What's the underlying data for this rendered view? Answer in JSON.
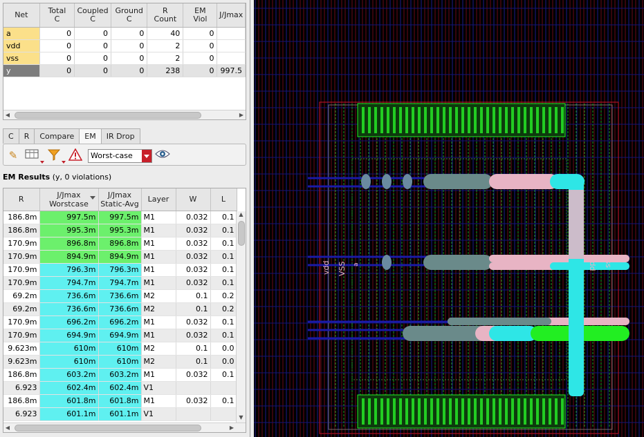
{
  "net_table": {
    "columns": [
      "Net",
      "Total\nC",
      "Coupled\nC",
      "Ground\nC",
      "R\nCount",
      "EM\nViol",
      "J/Jmax"
    ],
    "rows": [
      {
        "net": "a",
        "total_c": "0",
        "coupled_c": "0",
        "ground_c": "0",
        "r_count": "40",
        "em_viol": "0",
        "jjmax": ""
      },
      {
        "net": "vdd",
        "total_c": "0",
        "coupled_c": "0",
        "ground_c": "0",
        "r_count": "2",
        "em_viol": "0",
        "jjmax": ""
      },
      {
        "net": "vss",
        "total_c": "0",
        "coupled_c": "0",
        "ground_c": "0",
        "r_count": "2",
        "em_viol": "0",
        "jjmax": ""
      },
      {
        "net": "y",
        "total_c": "0",
        "coupled_c": "0",
        "ground_c": "0",
        "r_count": "238",
        "em_viol": "0",
        "jjmax": "997.5"
      }
    ]
  },
  "tabs": [
    "C",
    "R",
    "Compare",
    "EM",
    "IR Drop"
  ],
  "active_tab": "EM",
  "toolbar": {
    "mode": "Worst-case",
    "icons": [
      "pencil-icon",
      "column-chooser-icon",
      "filter-icon",
      "warning-icon",
      "eye-icon"
    ]
  },
  "em_results": {
    "title": "EM Results",
    "subtitle": "(y, 0 violations)",
    "columns": [
      "R",
      "J/Jmax\nWorstcase",
      "J/Jmax\nStatic-Avg",
      "Layer",
      "W",
      "L"
    ],
    "rows": [
      {
        "r": "186.8m",
        "wc": "997.5m",
        "sa": "997.5m",
        "layer": "M1",
        "w": "0.032",
        "l": "0.1",
        "color": "g"
      },
      {
        "r": "186.8m",
        "wc": "995.3m",
        "sa": "995.3m",
        "layer": "M1",
        "w": "0.032",
        "l": "0.1",
        "color": "g"
      },
      {
        "r": "170.9m",
        "wc": "896.8m",
        "sa": "896.8m",
        "layer": "M1",
        "w": "0.032",
        "l": "0.1",
        "color": "g"
      },
      {
        "r": "170.9m",
        "wc": "894.9m",
        "sa": "894.9m",
        "layer": "M1",
        "w": "0.032",
        "l": "0.1",
        "color": "g"
      },
      {
        "r": "170.9m",
        "wc": "796.3m",
        "sa": "796.3m",
        "layer": "M1",
        "w": "0.032",
        "l": "0.1",
        "color": "c"
      },
      {
        "r": "170.9m",
        "wc": "794.7m",
        "sa": "794.7m",
        "layer": "M1",
        "w": "0.032",
        "l": "0.1",
        "color": "c"
      },
      {
        "r": "69.2m",
        "wc": "736.6m",
        "sa": "736.6m",
        "layer": "M2",
        "w": "0.1",
        "l": "0.2",
        "color": "c"
      },
      {
        "r": "69.2m",
        "wc": "736.6m",
        "sa": "736.6m",
        "layer": "M2",
        "w": "0.1",
        "l": "0.2",
        "color": "c"
      },
      {
        "r": "170.9m",
        "wc": "696.2m",
        "sa": "696.2m",
        "layer": "M1",
        "w": "0.032",
        "l": "0.1",
        "color": "c"
      },
      {
        "r": "170.9m",
        "wc": "694.9m",
        "sa": "694.9m",
        "layer": "M1",
        "w": "0.032",
        "l": "0.1",
        "color": "c"
      },
      {
        "r": "9.623m",
        "wc": "610m",
        "sa": "610m",
        "layer": "M2",
        "w": "0.1",
        "l": "0.0",
        "color": "c"
      },
      {
        "r": "9.623m",
        "wc": "610m",
        "sa": "610m",
        "layer": "M2",
        "w": "0.1",
        "l": "0.0",
        "color": "c"
      },
      {
        "r": "186.8m",
        "wc": "603.2m",
        "sa": "603.2m",
        "layer": "M1",
        "w": "0.032",
        "l": "0.1",
        "color": "c"
      },
      {
        "r": "6.923",
        "wc": "602.4m",
        "sa": "602.4m",
        "layer": "V1",
        "w": "",
        "l": "",
        "color": "c"
      },
      {
        "r": "186.8m",
        "wc": "601.8m",
        "sa": "601.8m",
        "layer": "M1",
        "w": "0.032",
        "l": "0.1",
        "color": "c"
      },
      {
        "r": "6.923",
        "wc": "601.1m",
        "sa": "601.1m",
        "layer": "V1",
        "w": "",
        "l": "",
        "color": "c"
      }
    ]
  },
  "layout": {
    "labels": [
      "vdd",
      "VSS",
      "a",
      "vdd",
      "vss"
    ],
    "colors": {
      "background": "#000000",
      "green": "#22ee22",
      "cyan": "#2ee6e6",
      "pink": "#e8b4c4",
      "blue": "#1a1aa8",
      "red": "#c0142a"
    }
  }
}
